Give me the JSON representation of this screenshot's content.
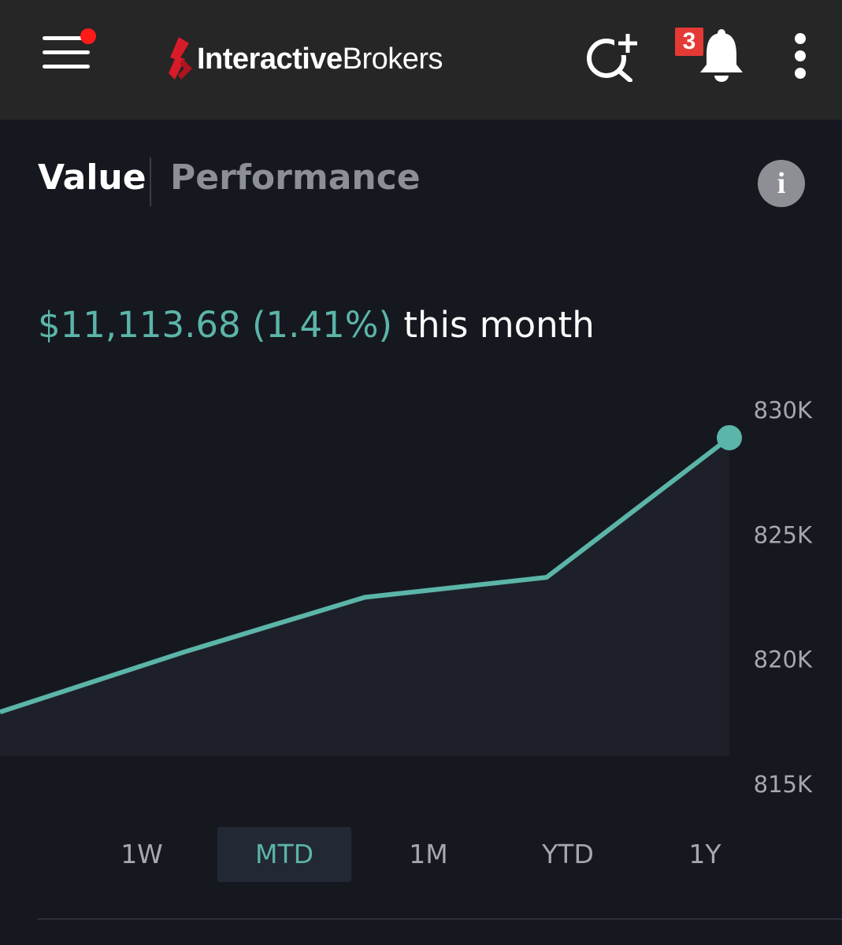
{
  "header": {
    "logo_text_bold": "Interactive",
    "logo_text_regular": "Brokers",
    "notification_count": "3",
    "icons": {
      "menu": "hamburger-menu-icon",
      "search": "search-add-icon",
      "bell": "bell-icon",
      "more": "kebab-menu-icon"
    },
    "colors": {
      "background": "#262626",
      "menu_dot": "#ff1a1a",
      "badge": "#e53935",
      "logo_mark": "#d81b29"
    }
  },
  "tabs": {
    "value_label": "Value",
    "performance_label": "Performance",
    "active": "Value"
  },
  "summary": {
    "change_text": "$11,113.68 (1.41%)",
    "period_text": "this month",
    "change_color": "#5bb5a8"
  },
  "chart_data": {
    "type": "area",
    "x": [
      1,
      2,
      3,
      4,
      5
    ],
    "values": [
      817.9,
      820.3,
      822.5,
      823.3,
      828.9
    ],
    "ylim": [
      815,
      830
    ],
    "yticks": [
      815,
      820,
      825,
      830
    ],
    "ytick_labels": [
      "815K",
      "820K",
      "825K",
      "830K"
    ],
    "line_color": "#5bb5a8",
    "fill_color": "#1d2029",
    "grid": false
  },
  "ranges": {
    "items": [
      "1W",
      "MTD",
      "1M",
      "YTD",
      "1Y"
    ],
    "active": "MTD",
    "active_color": "#5bb5a8"
  }
}
